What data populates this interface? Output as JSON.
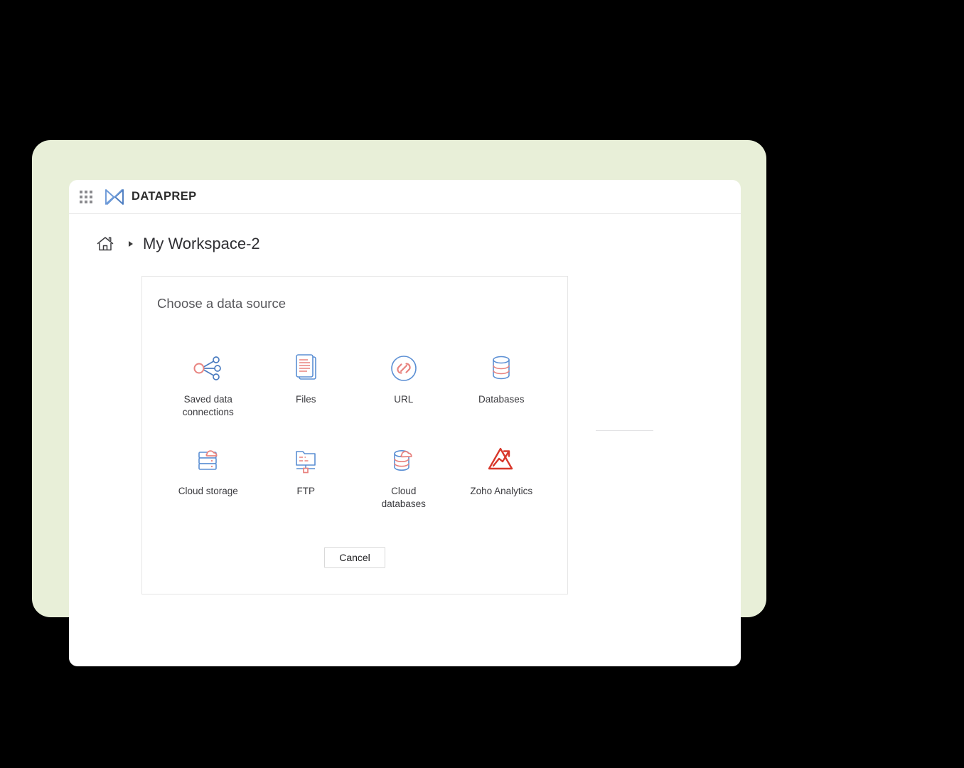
{
  "window": {
    "topbar": {
      "apps_grid_icon": "grid-apps-icon",
      "logo_icon": "dataprep-logo-icon",
      "title": "DATAPREP"
    },
    "breadcrumb": {
      "home_icon": "home-icon",
      "separator_icon": "chevron-right-icon",
      "current": "My Workspace-2"
    }
  },
  "dialog": {
    "heading": "Choose a data source",
    "sources": [
      {
        "label": "Saved data connections",
        "icon": "share-nodes-icon"
      },
      {
        "label": "Files",
        "icon": "documents-stack-icon"
      },
      {
        "label": "URL",
        "icon": "link-circle-icon"
      },
      {
        "label": "Databases",
        "icon": "database-cylinder-icon"
      },
      {
        "label": "Cloud storage",
        "icon": "cloud-server-icon"
      },
      {
        "label": "FTP",
        "icon": "ftp-folder-icon"
      },
      {
        "label": "Cloud databases",
        "icon": "cloud-database-icon"
      },
      {
        "label": "Zoho Analytics",
        "icon": "zoho-analytics-icon"
      }
    ],
    "cancel_label": "Cancel"
  },
  "colors": {
    "accent_blue": "#5b8fd4",
    "accent_salmon": "#e8827e",
    "zoho_red": "#d8372b",
    "backdrop_green": "#e8efd8",
    "page_background": "#000000"
  }
}
